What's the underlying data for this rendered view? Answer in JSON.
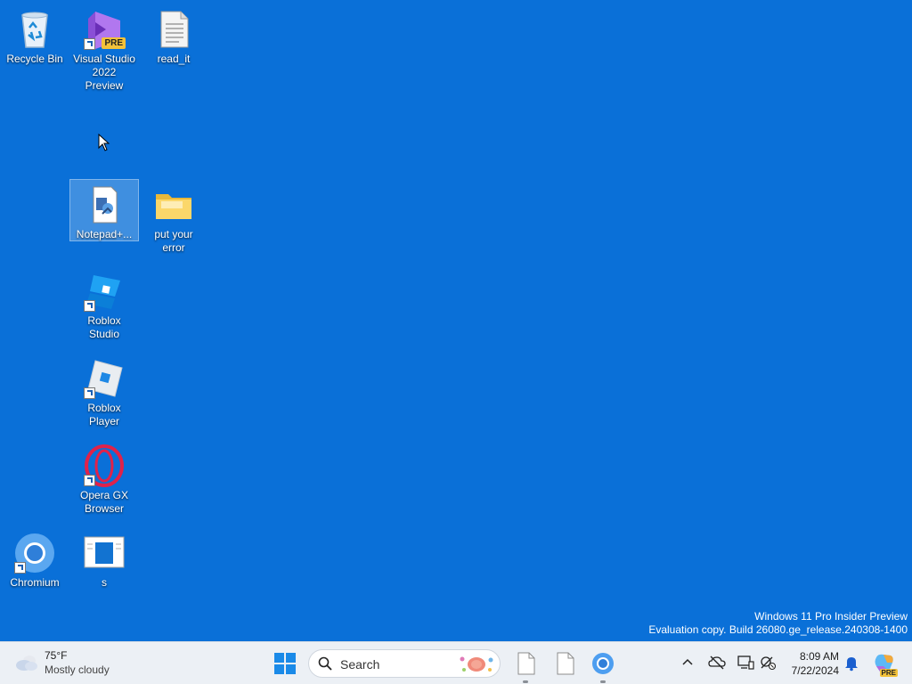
{
  "desktop": {
    "icons": [
      {
        "label": "Recycle Bin",
        "icon": "recycle-bin-icon"
      },
      {
        "label": "Visual Studio 2022 Preview",
        "icon": "visual-studio-icon",
        "badge": "PRE"
      },
      {
        "label": "read_it",
        "icon": "text-file-icon"
      },
      {
        "label": "Notepad+...",
        "icon": "notepad-plus-plus-icon"
      },
      {
        "label": "put your error",
        "icon": "folder-icon"
      },
      {
        "label": "Roblox Studio",
        "icon": "roblox-studio-icon"
      },
      {
        "label": "Roblox Player",
        "icon": "roblox-player-icon"
      },
      {
        "label": "Opera GX Browser",
        "icon": "opera-gx-icon"
      },
      {
        "label": "Chromium",
        "icon": "chromium-icon"
      },
      {
        "label": "s",
        "icon": "document-thumbnail-icon"
      }
    ],
    "selected_label": "Notepad+..."
  },
  "watermark": {
    "line1": "Windows 11 Pro Insider Preview",
    "line2": "Evaluation copy. Build 26080.ge_release.240308-1400"
  },
  "taskbar": {
    "weather": {
      "temp": "75°F",
      "condition": "Mostly cloudy",
      "icon": "cloud-icon"
    },
    "start_icon": "windows-logo-icon",
    "search": {
      "placeholder": "Search"
    },
    "pinned": [
      {
        "icon": "file-icon"
      },
      {
        "icon": "file-icon"
      },
      {
        "icon": "chromium-icon"
      }
    ],
    "tray": {
      "icons": [
        "chevron-up-icon",
        "onedrive-offline-icon",
        "display-icon",
        "network-disconnected-icon"
      ],
      "time": "8:09 AM",
      "date": "7/22/2024",
      "notification_icon": "bell-icon",
      "copilot_badge": "PRE"
    },
    "colors": {
      "desktop": "#0a70d8",
      "taskbar": "#ecf0f5",
      "accent": "#0067c0"
    }
  }
}
